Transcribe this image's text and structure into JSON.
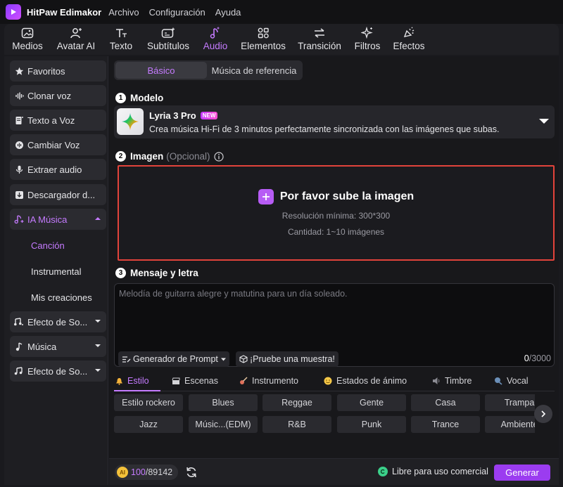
{
  "app": {
    "name": "HitPaw Edimakor",
    "menu": [
      "Archivo",
      "Configuración",
      "Ayuda"
    ]
  },
  "toolbar": {
    "items": [
      {
        "label": "Medios",
        "icon": "image-icon"
      },
      {
        "label": "Avatar AI",
        "icon": "avatar-icon"
      },
      {
        "label": "Texto",
        "icon": "text-icon"
      },
      {
        "label": "Subtítulos",
        "icon": "subtitles-icon"
      },
      {
        "label": "Audio",
        "icon": "music-note-icon",
        "active": true
      },
      {
        "label": "Elementos",
        "icon": "elements-icon"
      },
      {
        "label": "Transición",
        "icon": "transition-icon"
      },
      {
        "label": "Filtros",
        "icon": "sparkle-icon"
      },
      {
        "label": "Efectos",
        "icon": "effects-icon"
      }
    ]
  },
  "sidebar": {
    "items": [
      {
        "label": "Favoritos",
        "icon": "star-icon"
      },
      {
        "label": "Clonar voz",
        "icon": "voice-wave-icon"
      },
      {
        "label": "Texto a Voz",
        "icon": "document-icon"
      },
      {
        "label": "Cambiar Voz",
        "icon": "voice-change-icon"
      },
      {
        "label": "Extraer audio",
        "icon": "microphone-icon"
      },
      {
        "label": "Descargador d...",
        "icon": "download-icon"
      },
      {
        "label": "IA Música",
        "icon": "ai-music-icon",
        "active": true,
        "expanded": true
      },
      {
        "label": "Efecto de So...",
        "icon": "sound-effect-icon"
      },
      {
        "label": "Música",
        "icon": "music-note-icon"
      },
      {
        "label": "Efecto de So...",
        "icon": "music-notes-icon"
      }
    ],
    "sub_items": [
      {
        "label": "Canción",
        "active": true
      },
      {
        "label": "Instrumental"
      },
      {
        "label": "Mis creaciones"
      }
    ]
  },
  "tabs": {
    "basic": "Básico",
    "reference": "Música de referencia"
  },
  "model": {
    "section": "Modelo",
    "name": "Lyria 3 Pro",
    "badge": "NEW",
    "description": "Crea música Hi-Fi de 3 minutos perfectamente sincronizada con las imágenes que subas."
  },
  "image": {
    "section": "Imagen",
    "optional": "(Opcional)",
    "upload_title": "Por favor sube la imagen",
    "resolution": "Resolución mínima: 300*300",
    "quantity": "Cantidad: 1~10 imágenes"
  },
  "message": {
    "section": "Mensaje y letra",
    "placeholder": "Melodía de guitarra alegre y matutina para un día soleado.",
    "prompt_generator": "Generador de Prompt",
    "try_sample": "¡Pruebe una muestra!",
    "count": "0",
    "max": "/3000"
  },
  "categories": [
    {
      "label": "Estilo",
      "icon": "bell-icon",
      "active": true
    },
    {
      "label": "Escenas",
      "icon": "clapper-icon"
    },
    {
      "label": "Instrumento",
      "icon": "guitar-icon"
    },
    {
      "label": "Estados de ánimo",
      "icon": "emoji-icon"
    },
    {
      "label": "Timbre",
      "icon": "speaker-icon"
    },
    {
      "label": "Vocal",
      "icon": "vocal-icon"
    }
  ],
  "tags_row1": [
    "Estilo rockero",
    "Blues",
    "Reggae",
    "Gente",
    "Casa",
    "Trampa"
  ],
  "tags_row2": [
    "Jazz",
    "Músic...(EDM)",
    "R&B",
    "Punk",
    "Trance",
    "Ambiente"
  ],
  "footer": {
    "credits_used": "100",
    "credits_total": "/89142",
    "commercial": "Libre para uso comercial",
    "generate": "Generar"
  },
  "colors": {
    "accent": "#c57bff",
    "button": "#9b3cf0",
    "upload_border": "#e2433b",
    "free_green": "#3bd08a"
  }
}
